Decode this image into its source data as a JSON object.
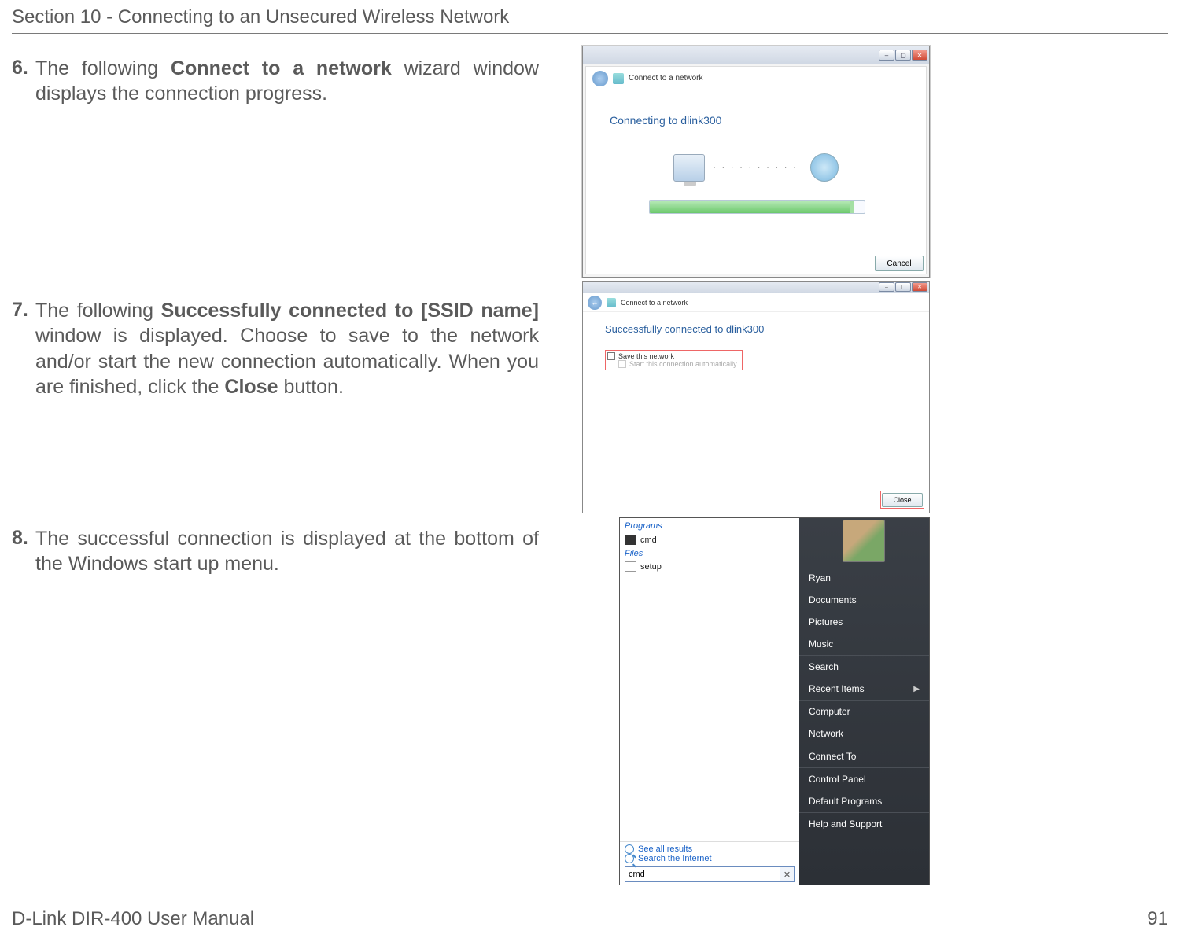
{
  "header": {
    "section_title": "Section 10 - Connecting to an Unsecured Wireless Network"
  },
  "footer": {
    "left": "D-Link DIR-400 User Manual",
    "page_no": "91"
  },
  "steps": {
    "s6": {
      "num": "6.",
      "pre": "The following ",
      "bold": "Connect to a network",
      "post": " wizard window displays the connection progress."
    },
    "s7": {
      "num": "7.",
      "pre": "The following ",
      "bold1": "Successfully connected to [SSID name]",
      "mid": " window is displayed. Choose to save to the network and/or start the new connection automatically. When you are finished, click the ",
      "bold2": "Close",
      "post": " button."
    },
    "s8": {
      "num": "8.",
      "text": "The successful connection is displayed at the bottom of the Windows start up menu."
    }
  },
  "win1": {
    "breadcrumb": "Connect to a network",
    "status": "Connecting to dlink300",
    "cancel": "Cancel"
  },
  "win2": {
    "breadcrumb": "Connect to a network",
    "status": "Successfully connected to dlink300",
    "save_label": "Save this network",
    "auto_label": "Start this connection automatically",
    "close": "Close"
  },
  "startmenu": {
    "programs_label": "Programs",
    "prog_cmd": "cmd",
    "files_label": "Files",
    "file_setup": "setup",
    "see_all": "See all results",
    "search_internet": "Search the Internet",
    "search_value": "cmd",
    "right_items": [
      "Ryan",
      "Documents",
      "Pictures",
      "Music",
      "Search",
      "Recent Items",
      "Computer",
      "Network",
      "Connect To",
      "Control Panel",
      "Default Programs",
      "Help and Support"
    ]
  }
}
